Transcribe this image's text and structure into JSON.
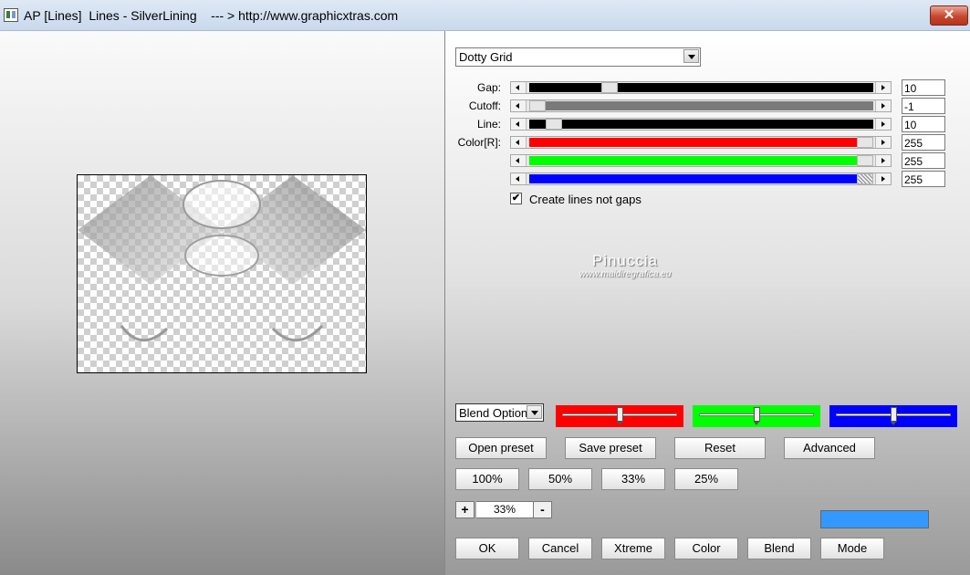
{
  "window": {
    "title": "AP [Lines]  Lines - SilverLining    --- > http://www.graphicxtras.com",
    "close_label": "✕"
  },
  "mode_select": {
    "value": "Dotty Grid"
  },
  "params": [
    {
      "label": "Gap:",
      "value": "10",
      "fraction": 0.22,
      "fill": "#000000"
    },
    {
      "label": "Cutoff:",
      "value": "-1",
      "fraction": 0.0,
      "fill": "#7a7a7a"
    },
    {
      "label": "Line:",
      "value": "10",
      "fraction": 0.05,
      "fill": "#000000"
    },
    {
      "label": "Color[R]:",
      "value": "255",
      "fraction": 1.0,
      "fill": "#ff0000"
    },
    {
      "label": "",
      "value": "255",
      "fraction": 1.0,
      "fill": "#00ff00"
    },
    {
      "label": "",
      "value": "255",
      "fraction": 1.0,
      "fill": "#0000ff"
    }
  ],
  "checkbox": {
    "label": "Create lines not gaps",
    "checked": true,
    "mark": "✔"
  },
  "watermark": {
    "line1": "Pinuccia",
    "line2": "www.maidiregrafica.eu"
  },
  "blend": {
    "value": "Blend Option"
  },
  "color_sliders": [
    {
      "color": "#ff0000",
      "fraction": 0.5
    },
    {
      "color": "#00ff00",
      "fraction": 0.5
    },
    {
      "color": "#0000ff",
      "fraction": 0.5
    }
  ],
  "preset_buttons": {
    "open": "Open preset",
    "save": "Save preset",
    "reset": "Reset",
    "advanced": "Advanced"
  },
  "zoom_buttons": [
    "100%",
    "50%",
    "33%",
    "25%"
  ],
  "zoom": {
    "plus": "+",
    "value": "33%",
    "minus": "-"
  },
  "swatch_color": "#3399ff",
  "bottom_buttons": {
    "ok": "OK",
    "cancel": "Cancel",
    "xtreme": "Xtreme",
    "color": "Color",
    "blend": "Blend",
    "mode": "Mode"
  }
}
